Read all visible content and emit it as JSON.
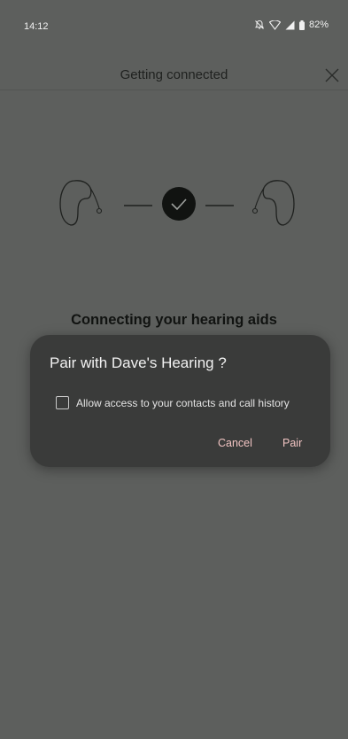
{
  "status_bar": {
    "time": "14:12",
    "battery": "82%"
  },
  "header": {
    "title": "Getting connected"
  },
  "main": {
    "connecting_title": "Connecting your hearing aids"
  },
  "dialog": {
    "title": "Pair with Dave's Hearing ?",
    "checkbox_label": "Allow access to your contacts and call history",
    "checkbox_checked": false,
    "cancel_label": "Cancel",
    "pair_label": "Pair"
  },
  "colors": {
    "background": "#5d5f5d",
    "dialog_background": "#3a3b3a",
    "button_text": "#f0c3c1"
  }
}
